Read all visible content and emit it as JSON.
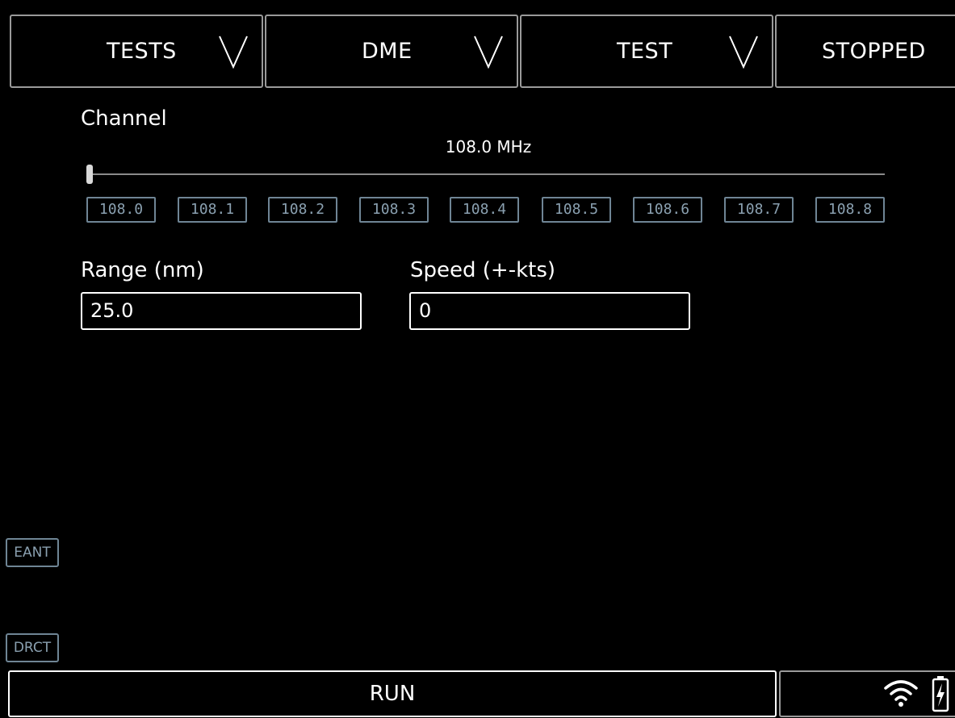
{
  "header": {
    "tests_label": "TESTS",
    "dme_label": "DME",
    "test_label": "TEST",
    "status_label": "STOPPED"
  },
  "channel": {
    "label": "Channel",
    "value_text": "108.0 MHz",
    "selected_fraction": 0.0,
    "presets": [
      "108.0",
      "108.1",
      "108.2",
      "108.3",
      "108.4",
      "108.5",
      "108.6",
      "108.7",
      "108.8"
    ]
  },
  "range": {
    "label": "Range (nm)",
    "value": "25.0"
  },
  "speed": {
    "label": "Speed (+-kts)",
    "value": "0"
  },
  "side_buttons": {
    "eant": "EANT",
    "drct": "DRCT"
  },
  "footer": {
    "run_label": "RUN",
    "icons": [
      "wifi-icon",
      "battery-charging-icon"
    ]
  }
}
